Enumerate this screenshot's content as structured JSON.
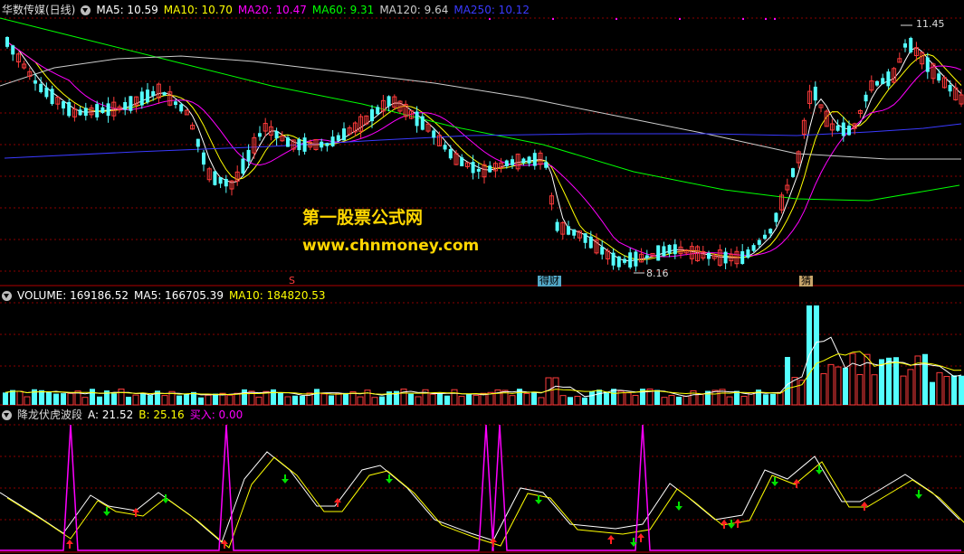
{
  "main_panel": {
    "title": "华数传媒(日线)",
    "ma": [
      {
        "label": "MA5: 10.59",
        "color": "#ffffff"
      },
      {
        "label": "MA10: 10.70",
        "color": "#ffff00"
      },
      {
        "label": "MA20: 10.47",
        "color": "#ff00ff"
      },
      {
        "label": "MA60: 9.31",
        "color": "#00ff00"
      },
      {
        "label": "MA120: 9.64",
        "color": "#cccccc"
      },
      {
        "label": "MA250: 10.12",
        "color": "#3a3aff"
      }
    ],
    "high_label": "11.45",
    "low_label": "8.16",
    "watermark_line1": "第一股票公式网",
    "watermark_line2": "www.chnmoney.com",
    "marker_s": "S",
    "marker_fin": "得财",
    "marker_b": "猜"
  },
  "volume_panel": {
    "title": "VOLUME: 169186.52",
    "ma5": "MA5: 166705.39",
    "ma10": "MA10: 184820.53",
    "colors": {
      "up": "#ff3b3b",
      "down": "#54ffff",
      "ma5": "#ffffff",
      "ma10": "#ffff00"
    }
  },
  "indicator_panel": {
    "title": "降龙伏虎波段",
    "a": "A: 21.52",
    "b": "B: 25.16",
    "buy": "买入: 0.00",
    "colors": {
      "a": "#ffffff",
      "b": "#ffff00",
      "buy": "#ff00ff"
    }
  },
  "colors": {
    "up_candle": "#ff3b3b",
    "down_candle": "#54ffff",
    "grid": "#8b0000",
    "separator": "#b00000"
  }
}
